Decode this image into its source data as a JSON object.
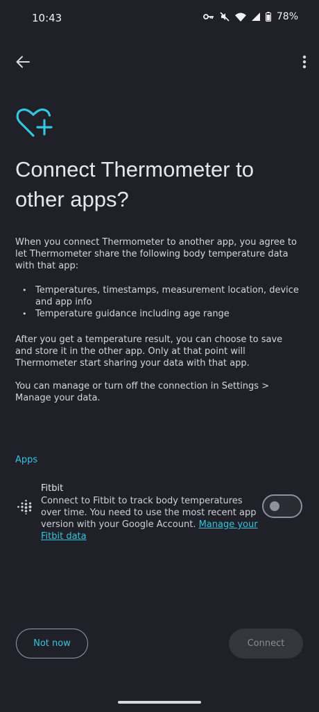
{
  "status_bar": {
    "time": "10:43",
    "battery": "78%",
    "icons": [
      "vpn-key-icon",
      "mute-icon",
      "wifi-icon",
      "signal-icon",
      "battery-icon"
    ]
  },
  "app_bar": {
    "back_icon": "arrow-left-icon",
    "menu_icon": "more-vert-icon"
  },
  "header": {
    "icon": "heart-plus-icon",
    "title": "Connect Thermometer to other apps?"
  },
  "body": {
    "intro": "When you connect Thermometer to another app, you agree to let Thermometer share the following body temperature data with that app:",
    "bullets": [
      "Temperatures, timestamps, measurement location, device and app info",
      "Temperature guidance including age range"
    ],
    "paragraph_2": "After you get a temperature result, you can choose to save and store it in the other app. Only at that point will Thermometer start sharing your data with that app.",
    "paragraph_3": "You can manage or turn off the connection in Settings > Manage your data."
  },
  "apps_section": {
    "header": "Apps",
    "items": [
      {
        "name": "Fitbit",
        "description": "Connect to Fitbit to track body temperatures over time. You need to use the most recent app version with your Google Account.",
        "link": "Manage your Fitbit data",
        "enabled": false
      }
    ]
  },
  "actions": {
    "secondary": "Not now",
    "primary": "Connect"
  },
  "colors": {
    "background": "#1f2028",
    "accent": "#35c5df",
    "disabled_button": "#34353d"
  }
}
